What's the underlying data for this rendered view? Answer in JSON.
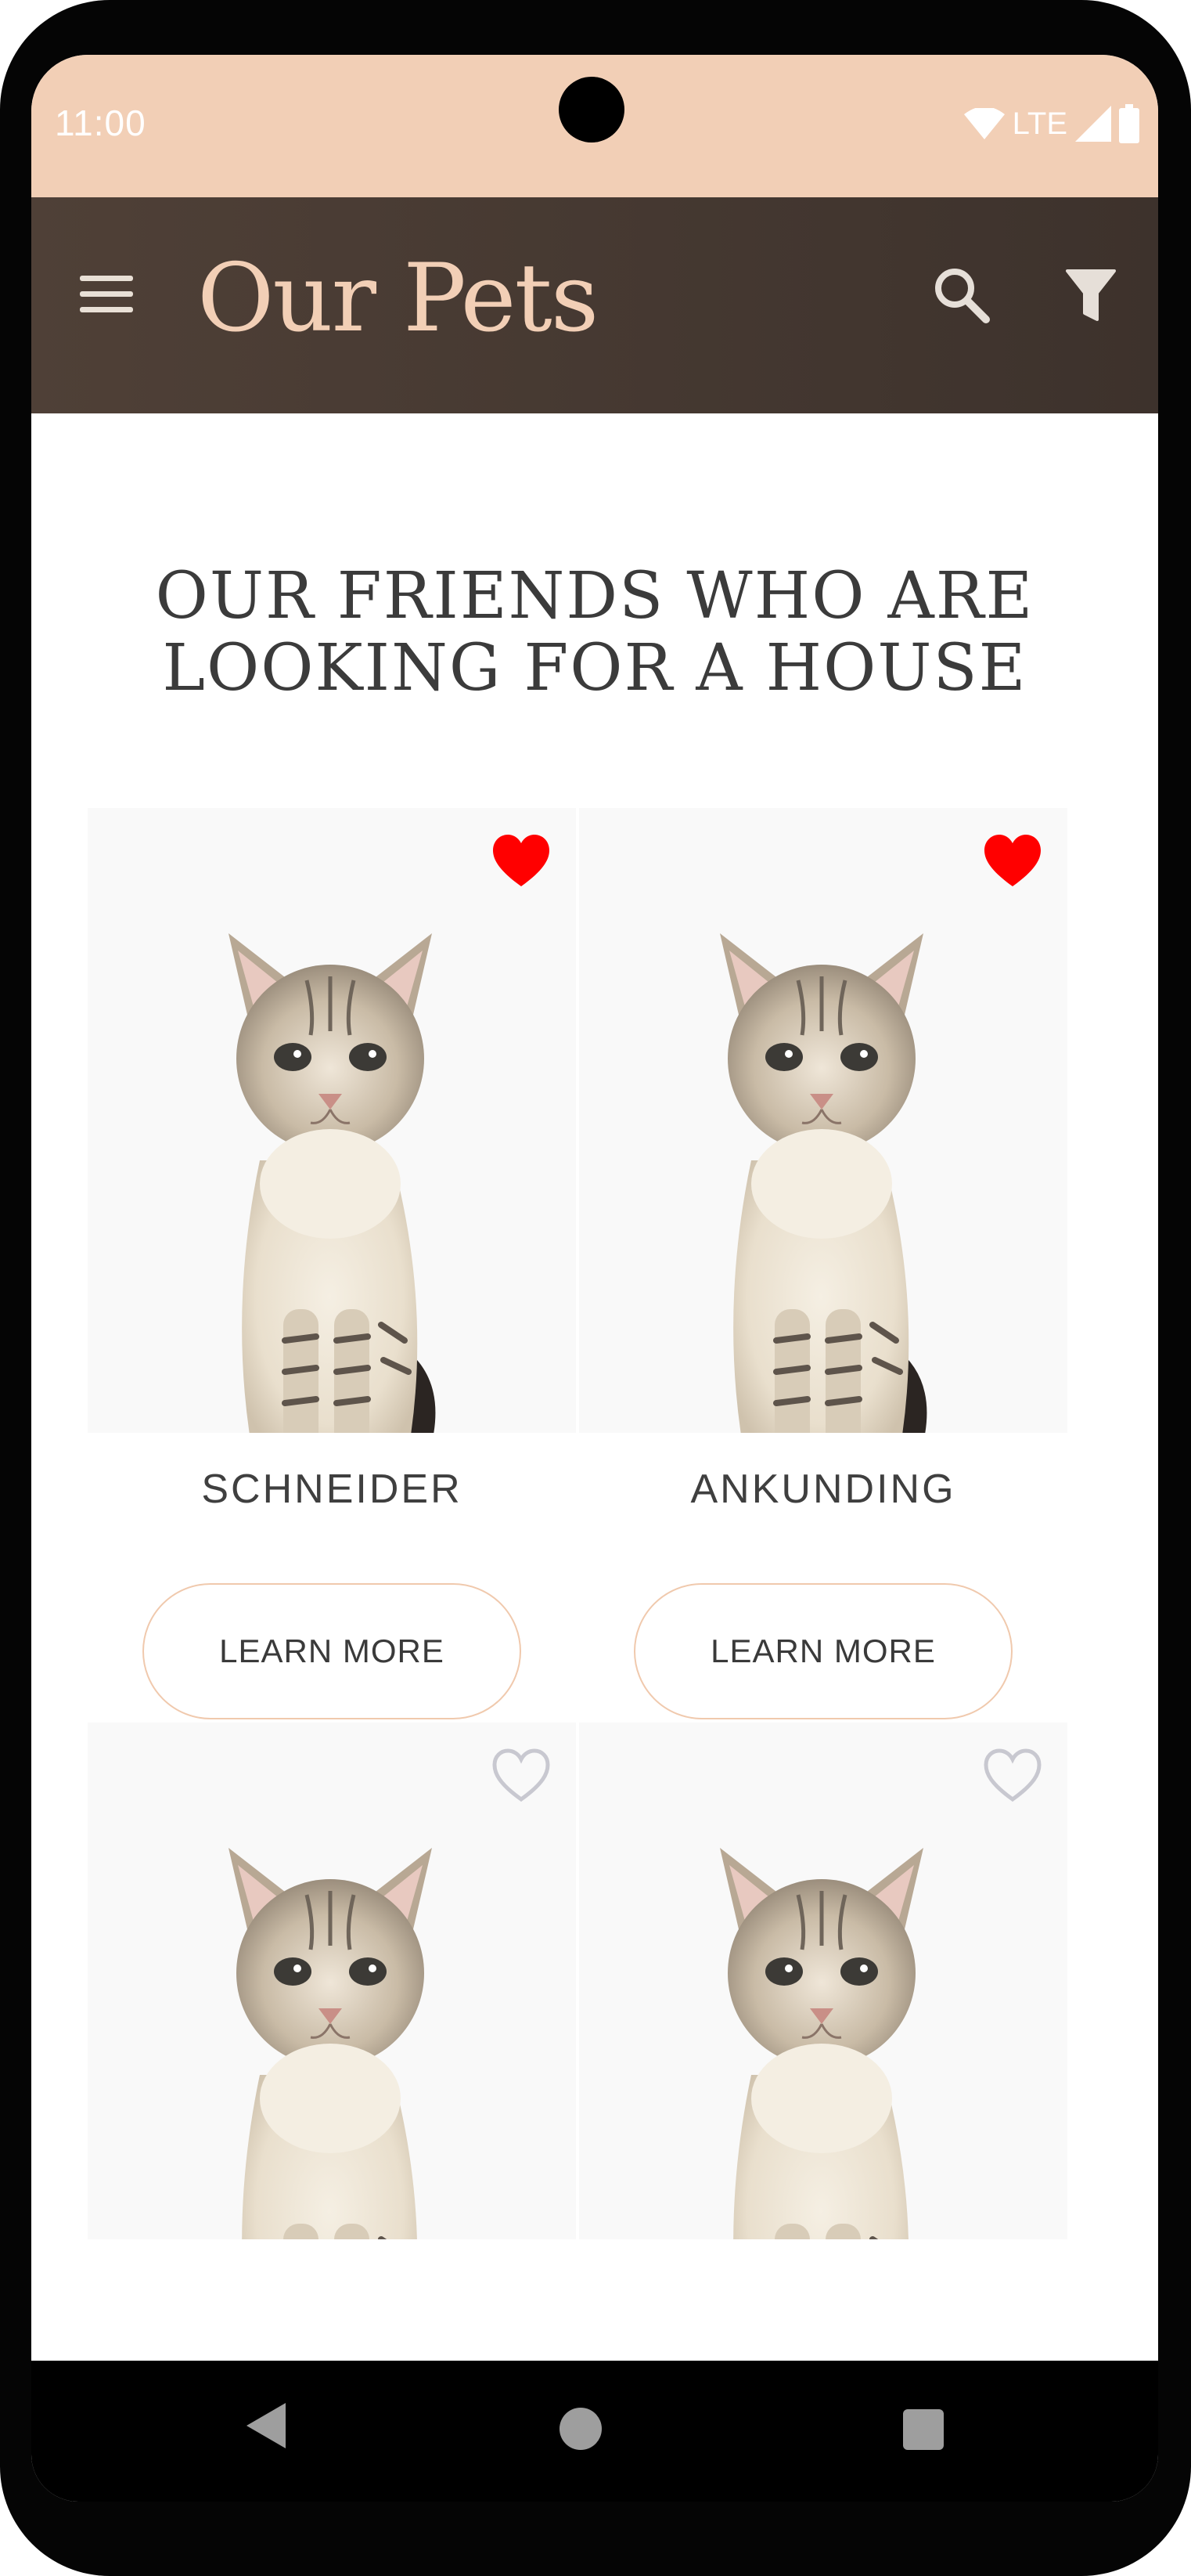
{
  "status_bar": {
    "time": "11:00",
    "network": "LTE",
    "icons": [
      "wifi-icon",
      "signal-icon",
      "battery-icon"
    ]
  },
  "app_bar": {
    "title": "Our Pets",
    "icons": [
      "menu-icon",
      "search-icon",
      "filter-icon"
    ]
  },
  "main": {
    "heading_line1": "OUR FRIENDS WHO ARE",
    "heading_line2": "LOOKING FOR A HOUSE",
    "pets": [
      {
        "name": "SCHNEIDER",
        "favorite": true,
        "button_label": "LEARN MORE"
      },
      {
        "name": "ANKUNDING",
        "favorite": true,
        "button_label": "LEARN MORE"
      },
      {
        "name": "",
        "favorite": false,
        "button_label": ""
      },
      {
        "name": "",
        "favorite": false,
        "button_label": ""
      }
    ]
  },
  "nav_bar": {
    "icons": [
      "back-icon",
      "home-icon",
      "recents-icon"
    ]
  },
  "colors": {
    "status_bar": "#f2cfb6",
    "app_bar": "#4a3c34",
    "title": "#f2cfb6",
    "favorite_active": "#ff0000",
    "favorite_inactive": "#c8c8d0",
    "button_border": "#f0c9ad"
  }
}
